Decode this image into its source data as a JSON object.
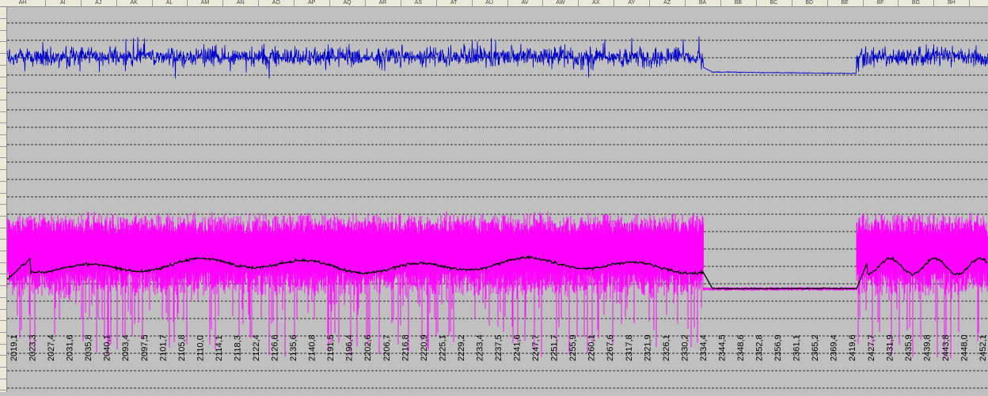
{
  "sheet": {
    "columns": [
      "AH",
      "AI",
      "AJ",
      "AK",
      "AL",
      "AM",
      "AN",
      "AO",
      "AP",
      "AQ",
      "AR",
      "AS",
      "AT",
      "AU",
      "AV",
      "AW",
      "AX",
      "AY",
      "AZ",
      "BA",
      "BB",
      "BC",
      "BD",
      "BE",
      "BF",
      "BG",
      "BH"
    ]
  },
  "chart_data": {
    "type": "line",
    "title": "",
    "xlabel": "",
    "ylabel": "",
    "grid": true,
    "x_tick_labels": [
      "2019,1",
      "2023,3",
      "2027,4",
      "2031,6",
      "2035,8",
      "2040,1",
      "2093,4",
      "2097,5",
      "2101,7",
      "2105,8",
      "2110,0",
      "2114,1",
      "2118,3",
      "2122,4",
      "2126,6",
      "2135,6",
      "2140,8",
      "2191,5",
      "2196,4",
      "2202,6",
      "2206,7",
      "2216,8",
      "2220,9",
      "2225,1",
      "2229,2",
      "2233,4",
      "2237,5",
      "2241,6",
      "2247,7",
      "2251,7",
      "2255,9",
      "2260,1",
      "2267,6",
      "2317,8",
      "2321,9",
      "2326,1",
      "2330,2",
      "2334,4",
      "2344,5",
      "2348,6",
      "2352,8",
      "2356,9",
      "2361,1",
      "2365,2",
      "2369,4",
      "2419,6",
      "2427,7",
      "2431,9",
      "2435,9",
      "2439,8",
      "2443,8",
      "2448,0",
      "2452,1"
    ],
    "series": [
      {
        "color": "#0000cc",
        "description_level": "upper noisy signal"
      },
      {
        "color": "#ff00ff",
        "description_level": "lower noisy signal"
      },
      {
        "color": "#000000",
        "description_level": "lower smoothed signal"
      }
    ]
  }
}
